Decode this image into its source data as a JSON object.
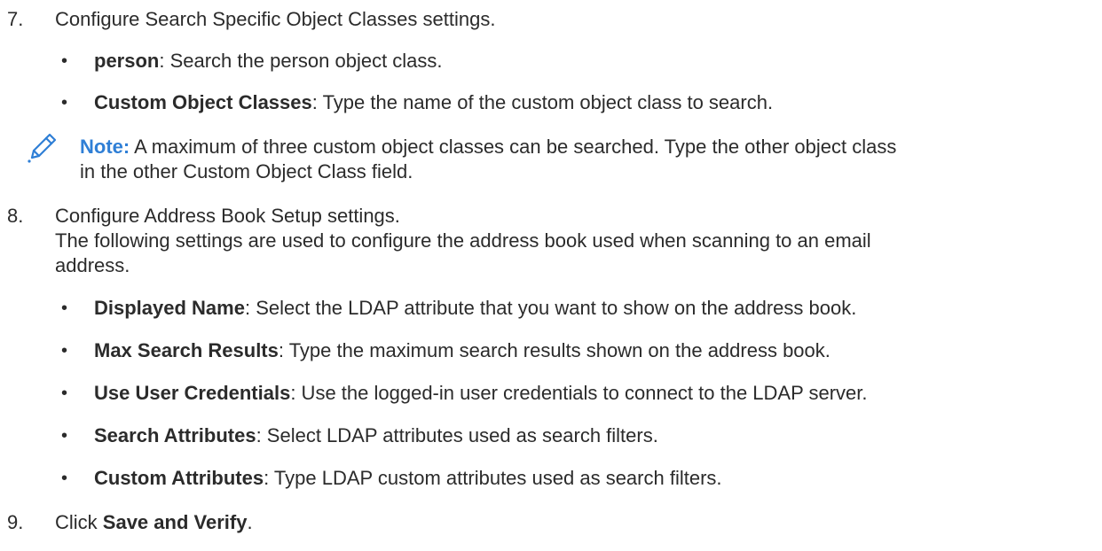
{
  "steps": {
    "s7": {
      "number": "7.",
      "text": "Configure Search Specific Object Classes settings.",
      "bullets": [
        {
          "term": "person",
          "desc": ": Search the person object class."
        },
        {
          "term": "Custom Object Classes",
          "desc": ": Type the name of the custom object class to search."
        }
      ],
      "note": {
        "label": "Note:",
        "line1": " A maximum of three custom object classes can be searched. Type the other object class",
        "line2": "in the other Custom Object Class field.",
        "icon": "pencil-icon"
      }
    },
    "s8": {
      "number": "8.",
      "text": "Configure Address Book Setup settings.",
      "desc_line1": "The following settings are used to configure the address book used when scanning to an email",
      "desc_line2": "address.",
      "bullets": [
        {
          "term": "Displayed Name",
          "desc": ": Select the LDAP attribute that you want to show on the address book."
        },
        {
          "term": "Max Search Results",
          "desc": ": Type the maximum search results shown on the address book."
        },
        {
          "term": "Use User Credentials",
          "desc": ": Use the logged-in user credentials to connect to the LDAP server."
        },
        {
          "term": "Search Attributes",
          "desc": ": Select LDAP attributes used as search filters."
        },
        {
          "term": "Custom Attributes",
          "desc": ": Type LDAP custom attributes used as search filters."
        }
      ]
    },
    "s9": {
      "number": "9.",
      "prefix": "Click ",
      "bold": "Save and Verify",
      "suffix": "."
    }
  },
  "bullet_glyph": "•",
  "colors": {
    "text": "#2b2b2b",
    "note_accent": "#2f7fd6"
  }
}
